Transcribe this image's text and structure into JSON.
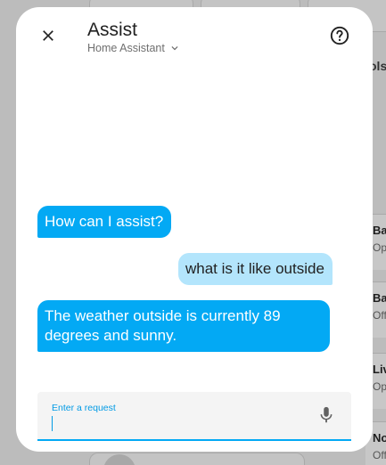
{
  "dialog": {
    "title": "Assist",
    "pipeline": "Home Assistant"
  },
  "conversation": [
    {
      "who": "hass",
      "text": "How can I assist?"
    },
    {
      "who": "user",
      "text": "what is it like outside"
    },
    {
      "who": "hass",
      "text": "The weather outside is currently 89 degrees and sunny."
    }
  ],
  "input": {
    "label": "Enter a request",
    "value": ""
  },
  "background": {
    "partial_header": "ols",
    "cards": [
      {
        "title": "Ba",
        "sub": "Op"
      },
      {
        "title": "Ba",
        "sub": "Off"
      },
      {
        "title": "Liv",
        "sub": "Op"
      },
      {
        "title": "No",
        "sub": "Off"
      }
    ]
  },
  "colors": {
    "accent": "#03a9f4",
    "user_bubble": "#b3e5fc",
    "dialog_bg": "#ffffff",
    "input_bg": "#f4f4f4"
  },
  "icons": {
    "close": "close-icon",
    "help": "help-circle-icon",
    "chevron": "chevron-down-icon",
    "mic": "microphone-icon"
  }
}
